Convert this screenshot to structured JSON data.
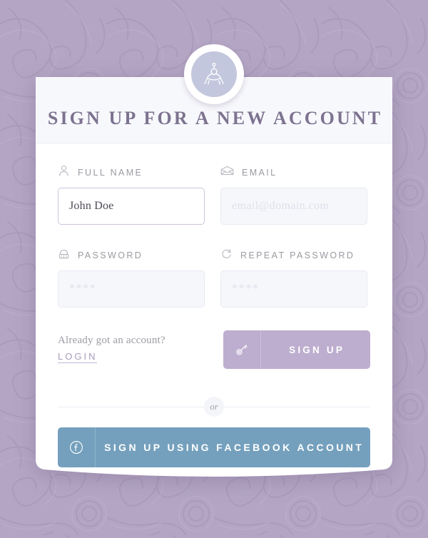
{
  "page": {
    "background_color": "#b4a5c4",
    "card_color": "#ffffff"
  },
  "emblem": {
    "icon": "compass-figure-logo",
    "ring_color": "#ffffff",
    "disc_color": "#c3c7dd"
  },
  "header": {
    "title": "SIGN UP FOR A NEW ACCOUNT",
    "title_color": "#7d7390"
  },
  "form": {
    "fields": [
      {
        "name": "full-name",
        "icon": "user-icon",
        "label": "FULL NAME",
        "value": "John Doe",
        "placeholder": "",
        "filled": true
      },
      {
        "name": "email",
        "icon": "envelope-icon",
        "label": "EMAIL",
        "value": "",
        "placeholder": "email@domain.com",
        "filled": false
      },
      {
        "name": "password",
        "icon": "lock-icon",
        "label": "PASSWORD",
        "value": "",
        "placeholder": "****",
        "filled": false
      },
      {
        "name": "repeat-password",
        "icon": "repeat-icon",
        "label": "REPEAT PASSWORD",
        "value": "",
        "placeholder": "****",
        "filled": false
      }
    ],
    "label_color": "#9a9aa2"
  },
  "actions": {
    "have_account_text": "Already got an account?",
    "login_label": "LOGIN",
    "login_color": "#a99bbc",
    "signup": {
      "label": "SIGN UP",
      "icon": "key-icon",
      "color": "#bdaecf"
    },
    "divider_text": "or",
    "facebook": {
      "label": "SIGN UP USING FACEBOOK ACCOUNT",
      "icon": "facebook-icon",
      "color": "#74a0bd"
    }
  }
}
